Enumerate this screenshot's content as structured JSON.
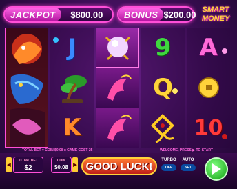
{
  "header": {
    "jackpot_label": "JACKPOT",
    "jackpot_value": "$800.00",
    "bonus_label": "BONUS",
    "bonus_value": "$200.00",
    "logo_line1": "SMART",
    "logo_line2": "MONEY"
  },
  "reels": [
    [
      "dragon-wild"
    ],
    [
      "J",
      "bonsai-tree",
      "K"
    ],
    [
      "pearl-claw",
      "red-crane",
      "red-crane"
    ],
    [
      "9",
      "Q",
      "golden-knot"
    ],
    [
      "A",
      "coin",
      "10"
    ]
  ],
  "info": {
    "left": "TOTAL BET = COIN $0.08 x GAME COST 25",
    "right": "WELCOME, PRESS ▶ TO START"
  },
  "controls": {
    "total_bet_label": "TOTAL BET",
    "total_bet_value": "$2",
    "coin_label": "COIN",
    "coin_value": "$0.08",
    "spin_message": "GOOD LUCK!",
    "turbo_label": "TURBO",
    "turbo_state": "OFF",
    "auto_label": "AUTO",
    "auto_state": "SET",
    "play_icon": "play-icon"
  },
  "colors": {
    "accent": "#ff4fd8",
    "gold": "#ffd43a",
    "play": "#22c022"
  }
}
